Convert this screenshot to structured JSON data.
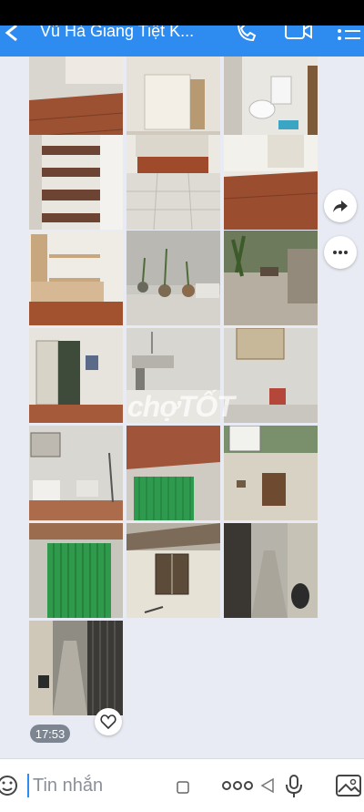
{
  "header": {
    "title": "Vũ Hà Giang Tiệt K...",
    "icons": [
      "back-icon",
      "phone-icon",
      "video-call-icon",
      "menu-list-icon"
    ]
  },
  "message": {
    "time": "17:53",
    "photo_count": 19,
    "watermark": "chợTỐT"
  },
  "composer": {
    "placeholder": "Tin nhắn",
    "icons": [
      "sticker-icon",
      "more-icon",
      "voice-icon",
      "image-icon"
    ]
  },
  "colors": {
    "header_bg": "#2e8cf0",
    "chat_bg": "#e8ebf3"
  }
}
